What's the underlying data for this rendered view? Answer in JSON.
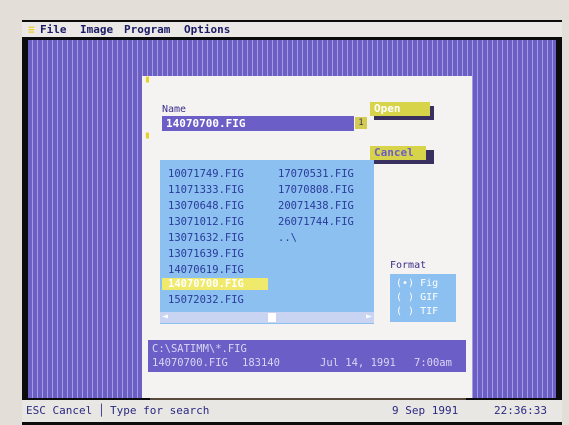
{
  "menu": {
    "file": "File",
    "image": "Image",
    "program": "Program",
    "options": "Options",
    "system_glyph": "≡"
  },
  "dialog": {
    "name_label": "Name",
    "name_value": "14070700.FIG",
    "name_history_marker": "1",
    "open_button": "Open",
    "cancel_button": "Cancel",
    "files": [
      "10071749.FIG",
      "11071333.FIG",
      "13070648.FIG",
      "13071012.FIG",
      "13071632.FIG",
      "13071639.FIG",
      "14070619.FIG",
      "14070700.FIG",
      "15072032.FIG",
      "17070531.FIG",
      "17070808.FIG",
      "20071438.FIG",
      "26071744.FIG",
      "..\\"
    ],
    "selected_file": "14070700.FIG",
    "format_label": "Format",
    "formats": [
      "(•) Fig",
      "( ) GIF",
      "( ) TIF"
    ],
    "path": "C:\\SATIMM\\*.FIG",
    "file_info": {
      "name": "14070700.FIG",
      "size": "183140",
      "date": "Jul 14, 1991",
      "time": "7:00am"
    }
  },
  "status": {
    "esc": "ESC Cancel",
    "hint": "Type for search",
    "date": "9 Sep 1991",
    "time": "22:36:33"
  },
  "colors": {
    "desktop": "#6b5fc4",
    "dialog": "#f5f3f2",
    "list": "#8cc0f0",
    "button": "#d8d44a",
    "highlight": "#f0ea6c"
  }
}
